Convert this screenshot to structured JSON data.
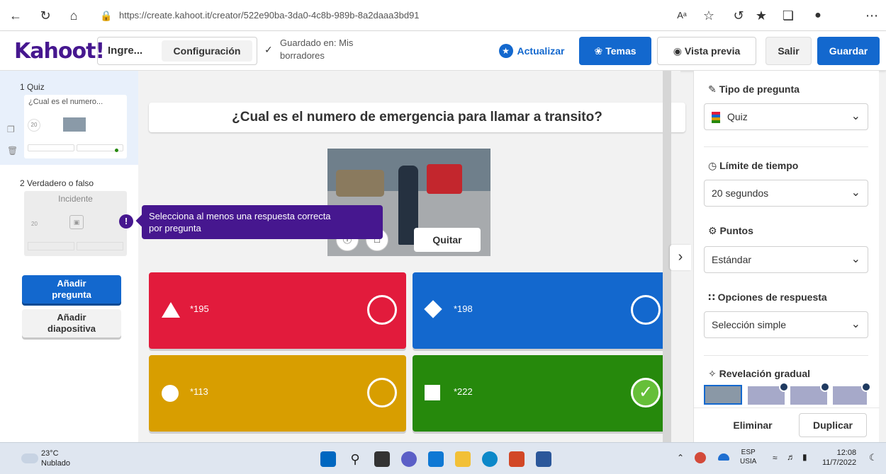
{
  "browser": {
    "url": "https://create.kahoot.it/creator/522e90ba-3da0-4c8b-989b-8a2daaa3bd91",
    "url_host": "create.kahoot.it",
    "reader_label": "Aᵃ"
  },
  "header": {
    "logo": "Kahoot!",
    "title_input": "Ingre...",
    "settings_label": "Configuración",
    "saved_line1": "Guardado en: Mis",
    "saved_line2": "borradores",
    "upgrade_label": "Actualizar",
    "themes_label": "Temas",
    "preview_label": "Vista previa",
    "exit_label": "Salir",
    "save_label": "Guardar"
  },
  "sidebar": {
    "items": [
      {
        "number": "1",
        "type": "Quiz",
        "title": "¿Cual es el numero...",
        "time": "20"
      },
      {
        "number": "2",
        "type": "Verdadero o falso",
        "title": "Incidente",
        "time": "20"
      }
    ],
    "add_question_line1": "Añadir",
    "add_question_line2": "pregunta",
    "add_slide_line1": "Añadir",
    "add_slide_line2": "diapositiva"
  },
  "tooltip": {
    "line1": "Selecciona al menos una respuesta correcta",
    "line2": "por pregunta"
  },
  "question": {
    "text": "¿Cual es el numero de emergencia para llamar a transito?",
    "remove_image_label": "Quitar"
  },
  "answers": [
    {
      "text": "*195",
      "color": "#e21b3c",
      "shape": "triangle",
      "correct": false
    },
    {
      "text": "*198",
      "color": "#1368ce",
      "shape": "diamond",
      "correct": false
    },
    {
      "text": "*113",
      "color": "#d89e00",
      "shape": "circle",
      "correct": false
    },
    {
      "text": "*222",
      "color": "#26890c",
      "shape": "square",
      "correct": true
    }
  ],
  "panel": {
    "question_type_label": "Tipo de pregunta",
    "question_type_value": "Quiz",
    "time_limit_label": "Límite de tiempo",
    "time_limit_value": "20 segundos",
    "points_label": "Puntos",
    "points_value": "Estándar",
    "answer_options_label": "Opciones de respuesta",
    "answer_options_value": "Selección simple",
    "reveal_label": "Revelación gradual",
    "delete_label": "Eliminar",
    "duplicate_label": "Duplicar"
  },
  "taskbar": {
    "temperature": "23°C",
    "weather": "Nublado",
    "lang_top": "ESP",
    "lang_bottom": "USIA",
    "time": "12:08",
    "date": "11/7/2022"
  },
  "colors": {
    "brand": "#46178f",
    "primary": "#1368ce",
    "red": "#e21b3c",
    "blue": "#1368ce",
    "yellow": "#d89e00",
    "green": "#26890c",
    "tooltip": "#46178f"
  }
}
